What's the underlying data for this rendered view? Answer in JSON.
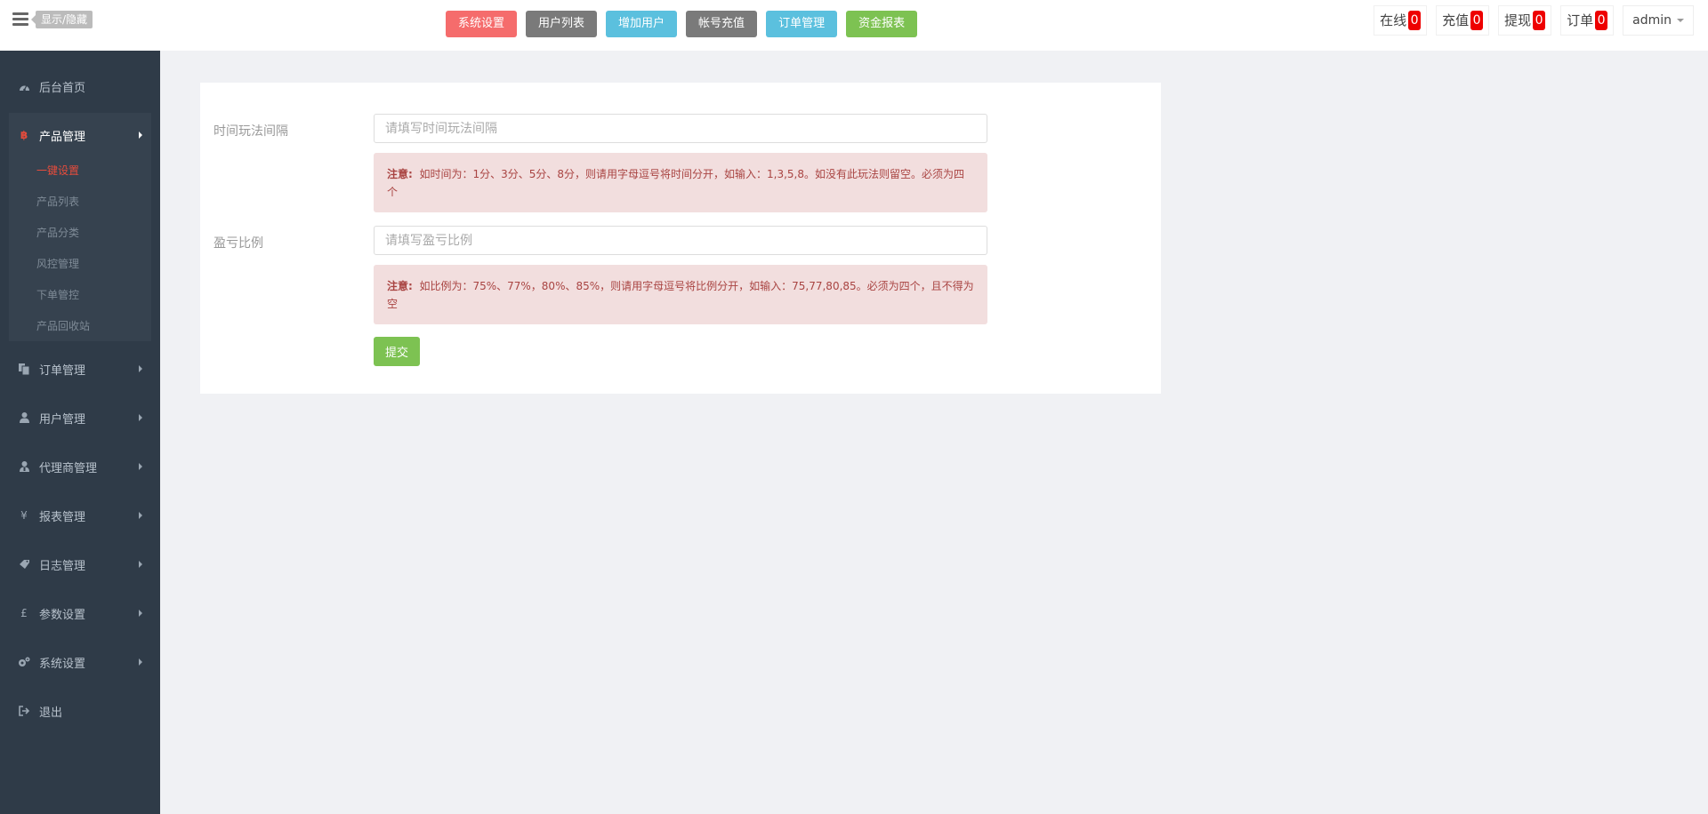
{
  "header": {
    "toggle_tip": "显示/隐藏",
    "quick_buttons": [
      {
        "label": "系统设置",
        "color": "#f56c6c"
      },
      {
        "label": "用户列表",
        "color": "#7a7a7a"
      },
      {
        "label": "增加用户",
        "color": "#5bc0de"
      },
      {
        "label": "帐号充值",
        "color": "#7a7a7a"
      },
      {
        "label": "订单管理",
        "color": "#5bc0de"
      },
      {
        "label": "资金报表",
        "color": "#7dc252"
      }
    ],
    "stats": [
      {
        "label": "在线",
        "count": "0"
      },
      {
        "label": "充值",
        "count": "0"
      },
      {
        "label": "提现",
        "count": "0"
      },
      {
        "label": "订单",
        "count": "0"
      }
    ],
    "user": "admin"
  },
  "sidebar": {
    "items": [
      {
        "label": "后台首页",
        "icon": "dashboard-icon"
      },
      {
        "label": "产品管理",
        "icon": "bitcoin-icon"
      },
      {
        "label": "订单管理",
        "icon": "files-icon"
      },
      {
        "label": "用户管理",
        "icon": "user-icon"
      },
      {
        "label": "代理商管理",
        "icon": "agent-icon"
      },
      {
        "label": "报表管理",
        "icon": "yen-icon"
      },
      {
        "label": "日志管理",
        "icon": "tag-icon"
      },
      {
        "label": "参数设置",
        "icon": "pound-icon"
      },
      {
        "label": "系统设置",
        "icon": "gears-icon"
      },
      {
        "label": "退出",
        "icon": "sign-out-icon"
      }
    ],
    "sub_items": [
      "一键设置",
      "产品列表",
      "产品分类",
      "风控管理",
      "下单管控",
      "产品回收站"
    ]
  },
  "form": {
    "fields": [
      {
        "label": "时间玩法间隔",
        "placeholder": "请填写时间玩法间隔",
        "value": "",
        "note_title": "注意:",
        "note": "如时间为：1分、3分、5分、8分，则请用字母逗号将时间分开，如输入：1,3,5,8。如没有此玩法则留空。必须为四个"
      },
      {
        "label": "盈亏比例",
        "placeholder": "请填写盈亏比例",
        "value": "",
        "note_title": "注意:",
        "note": "如比例为：75%、77%，80%、85%，则请用字母逗号将比例分开，如输入：75,77,80,85。必须为四个，且不得为空"
      }
    ],
    "submit_label": "提交"
  }
}
